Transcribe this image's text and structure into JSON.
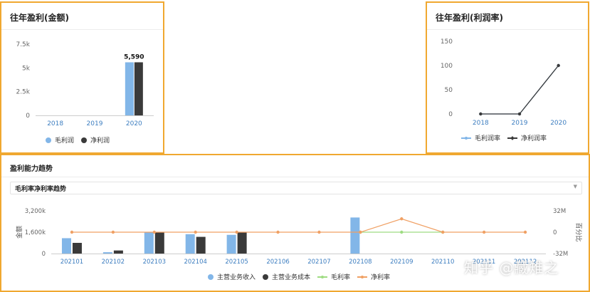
{
  "colors": {
    "frame": "#f0a830",
    "gross": "#82b6e8",
    "net": "#3a3a3a",
    "gross_rate_line": "#9edc82",
    "net_rate_line": "#f0a064",
    "axis_blue": "#3d7ec0"
  },
  "panel_amount": {
    "title": "往年盈利(金额)",
    "legend": [
      {
        "label": "毛利润",
        "icon": "circle",
        "color": "#82b6e8"
      },
      {
        "label": "净利润",
        "icon": "circle",
        "color": "#3a3a3a"
      }
    ]
  },
  "panel_rate": {
    "title": "往年盈利(利润率)",
    "legend": [
      {
        "label": "毛利润率",
        "icon": "line-circle",
        "color": "#82b6e8"
      },
      {
        "label": "净利润率",
        "icon": "line-diamond",
        "color": "#3a3a3a"
      }
    ]
  },
  "panel_trend": {
    "title": "盈利能力趋势",
    "select_value": "毛利率净利率趋势",
    "left_axis_label": "金额",
    "right_axis_label": "百分比",
    "legend": [
      {
        "label": "主营业务收入",
        "icon": "circle",
        "color": "#82b6e8"
      },
      {
        "label": "主营业务成本",
        "icon": "circle",
        "color": "#3a3a3a"
      },
      {
        "label": "毛利率",
        "icon": "line",
        "color": "#9edc82"
      },
      {
        "label": "净利率",
        "icon": "line",
        "color": "#f0a064"
      }
    ]
  },
  "watermark": "知乎 @藏雉之",
  "chart_data": [
    {
      "type": "bar",
      "categories": [
        "2018",
        "2019",
        "2020"
      ],
      "series": [
        {
          "name": "毛利润",
          "values": [
            0,
            0,
            5590
          ]
        },
        {
          "name": "净利润",
          "values": [
            0,
            0,
            5590
          ]
        }
      ],
      "data_labels": [
        "",
        "",
        "5,590"
      ],
      "yticks": [
        "0",
        "2.5k",
        "5k",
        "7.5k"
      ],
      "ylim": [
        0,
        7500
      ],
      "grid": false,
      "legend": "bottom"
    },
    {
      "type": "line",
      "categories": [
        "2018",
        "2019",
        "2020"
      ],
      "series": [
        {
          "name": "毛利润率",
          "values": [
            0,
            0,
            100
          ]
        },
        {
          "name": "净利润率",
          "values": [
            0,
            0,
            100
          ]
        }
      ],
      "yticks": [
        "0",
        "50",
        "100",
        "150"
      ],
      "ylim": [
        0,
        150
      ],
      "grid": false,
      "legend": "bottom"
    },
    {
      "type": "bar",
      "categories": [
        "202101",
        "202102",
        "202103",
        "202104",
        "202105",
        "202106",
        "202107",
        "202108",
        "202109",
        "202110",
        "202111",
        "202112"
      ],
      "series": [
        {
          "name": "主营业务收入",
          "axis": "left",
          "values": [
            1150000,
            100000,
            1600000,
            1450000,
            1400000,
            0,
            0,
            2700000,
            0,
            0,
            0,
            0
          ]
        },
        {
          "name": "主营业务成本",
          "axis": "left",
          "values": [
            800000,
            230000,
            1600000,
            1250000,
            1600000,
            0,
            0,
            0,
            0,
            0,
            0,
            0
          ]
        },
        {
          "name": "毛利率",
          "axis": "right",
          "type": "line",
          "values": [
            null,
            null,
            null,
            null,
            null,
            null,
            null,
            0,
            0,
            0,
            null,
            null
          ]
        },
        {
          "name": "净利率",
          "axis": "right",
          "type": "line",
          "values": [
            0,
            0,
            0,
            0,
            0,
            0,
            0,
            0,
            20000000,
            0,
            0,
            0
          ]
        }
      ],
      "yticks_left": [
        "0",
        "1,600k",
        "3,200k"
      ],
      "ylim_left": [
        0,
        3200000
      ],
      "yticks_right": [
        "-32M",
        "0",
        "32M"
      ],
      "ylim_right": [
        -32000000,
        32000000
      ],
      "xlabel": "",
      "ylabel": "金额",
      "ylabel_right": "百分比",
      "grid": false,
      "legend": "bottom"
    }
  ]
}
